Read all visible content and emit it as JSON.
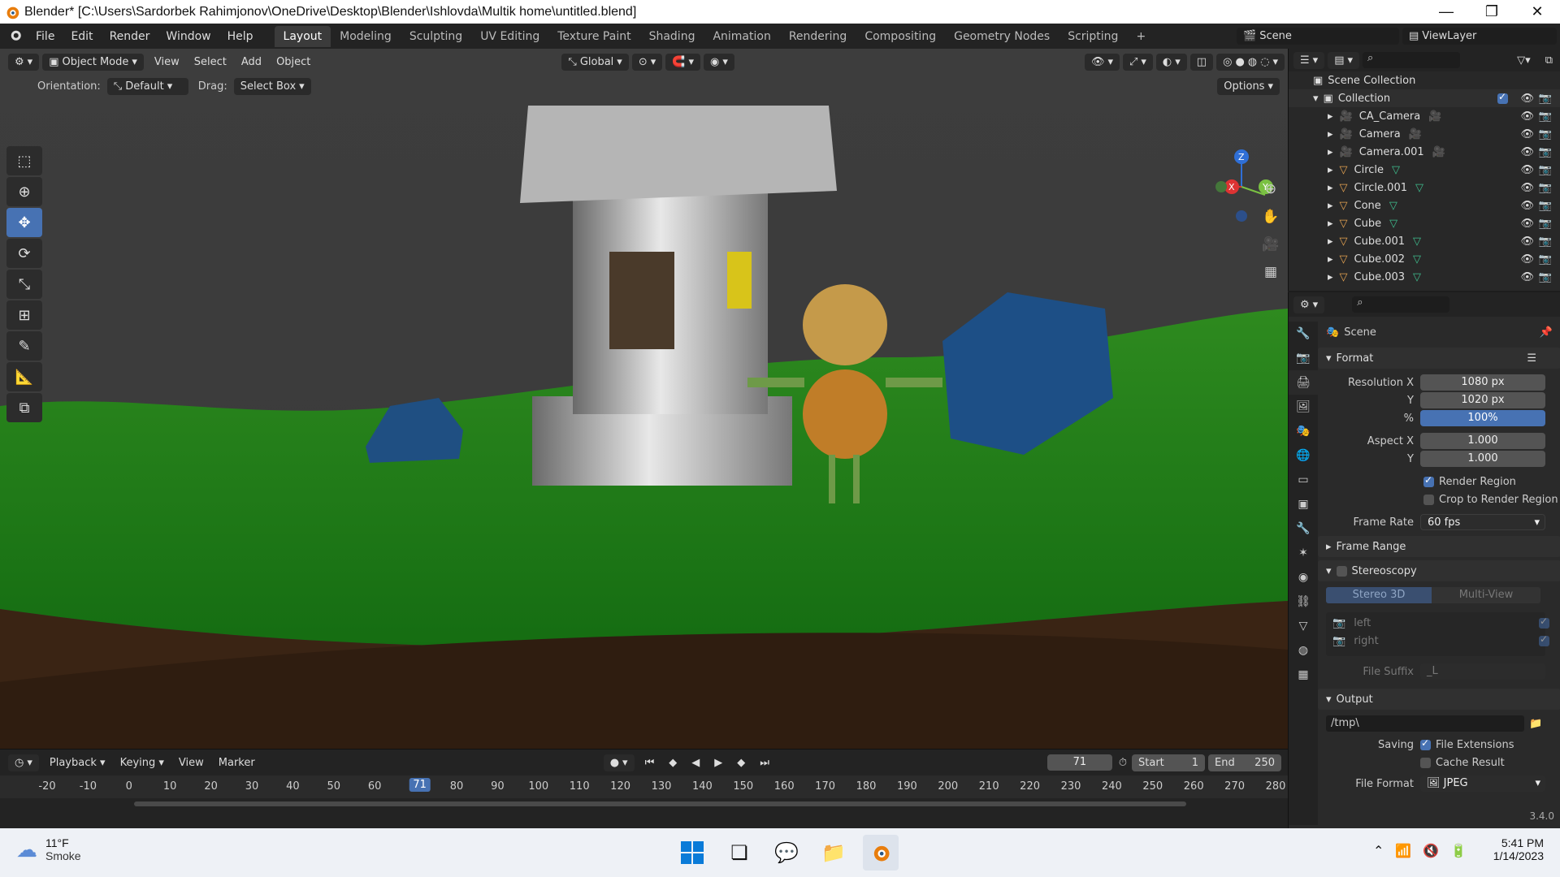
{
  "window": {
    "title": "Blender* [C:\\Users\\Sardorbek Rahimjonov\\OneDrive\\Desktop\\Blender\\Ishlovda\\Multik home\\untitled.blend]"
  },
  "menu": {
    "items": [
      "File",
      "Edit",
      "Render",
      "Window",
      "Help"
    ]
  },
  "workspaces": [
    "Layout",
    "Modeling",
    "Sculpting",
    "UV Editing",
    "Texture Paint",
    "Shading",
    "Animation",
    "Rendering",
    "Compositing",
    "Geometry Nodes",
    "Scripting"
  ],
  "topright": {
    "scene": "Scene",
    "view_layer": "ViewLayer"
  },
  "viewport": {
    "mode": "Object Mode",
    "menus": [
      "View",
      "Select",
      "Add",
      "Object"
    ],
    "transform": "Global",
    "orientation_label": "Orientation:",
    "orientation_value": "Default",
    "drag_label": "Drag:",
    "drag_value": "Select Box",
    "options": "Options"
  },
  "gizmo": {
    "z": "Z",
    "x": "X",
    "y": "Y"
  },
  "timeline": {
    "menus": [
      "Playback",
      "Keying",
      "View",
      "Marker"
    ],
    "current_frame": "71",
    "start_label": "Start",
    "start": "1",
    "end_label": "End",
    "end": "250",
    "ticks": [
      "-20",
      "-10",
      "0",
      "10",
      "20",
      "30",
      "40",
      "50",
      "60",
      "80",
      "90",
      "100",
      "110",
      "120",
      "130",
      "140",
      "150",
      "160",
      "170",
      "180",
      "190",
      "200",
      "210",
      "220",
      "230",
      "240",
      "250",
      "260",
      "270",
      "280"
    ],
    "cursor_label": "71"
  },
  "outliner": {
    "root": "Scene Collection",
    "collection": "Collection",
    "items": [
      {
        "name": "CA_Camera",
        "type": "camera"
      },
      {
        "name": "Camera",
        "type": "camera"
      },
      {
        "name": "Camera.001",
        "type": "camera"
      },
      {
        "name": "Circle",
        "type": "mesh"
      },
      {
        "name": "Circle.001",
        "type": "mesh"
      },
      {
        "name": "Cone",
        "type": "mesh"
      },
      {
        "name": "Cube",
        "type": "mesh"
      },
      {
        "name": "Cube.001",
        "type": "mesh"
      },
      {
        "name": "Cube.002",
        "type": "mesh"
      },
      {
        "name": "Cube.003",
        "type": "mesh"
      }
    ]
  },
  "properties": {
    "context": "Scene",
    "format": {
      "header": "Format",
      "res_x_label": "Resolution X",
      "res_x": "1080 px",
      "res_y_label": "Y",
      "res_y": "1020 px",
      "pct_label": "%",
      "pct": "100%",
      "aspect_x_label": "Aspect X",
      "aspect_x": "1.000",
      "aspect_y_label": "Y",
      "aspect_y": "1.000",
      "render_region": "Render Region",
      "crop": "Crop to Render Region",
      "frame_rate_label": "Frame Rate",
      "frame_rate": "60 fps"
    },
    "frame_range": "Frame Range",
    "stereoscopy": {
      "header": "Stereoscopy",
      "tab1": "Stereo 3D",
      "tab2": "Multi-View",
      "left": "left",
      "right": "right",
      "file_suffix_label": "File Suffix",
      "file_suffix": "_L"
    },
    "output": {
      "header": "Output",
      "path": "/tmp\\",
      "saving_label": "Saving",
      "file_ext": "File Extensions",
      "cache": "Cache Result",
      "file_format_label": "File Format",
      "file_format": "JPEG"
    },
    "version": "3.4.0"
  },
  "taskbar": {
    "temp": "11°F",
    "weather": "Smoke",
    "time": "5:41 PM",
    "date": "1/14/2023"
  },
  "colors": {
    "accent": "#4772b3",
    "grass": "#1f8a1f",
    "bg": "#1d1d1d"
  }
}
